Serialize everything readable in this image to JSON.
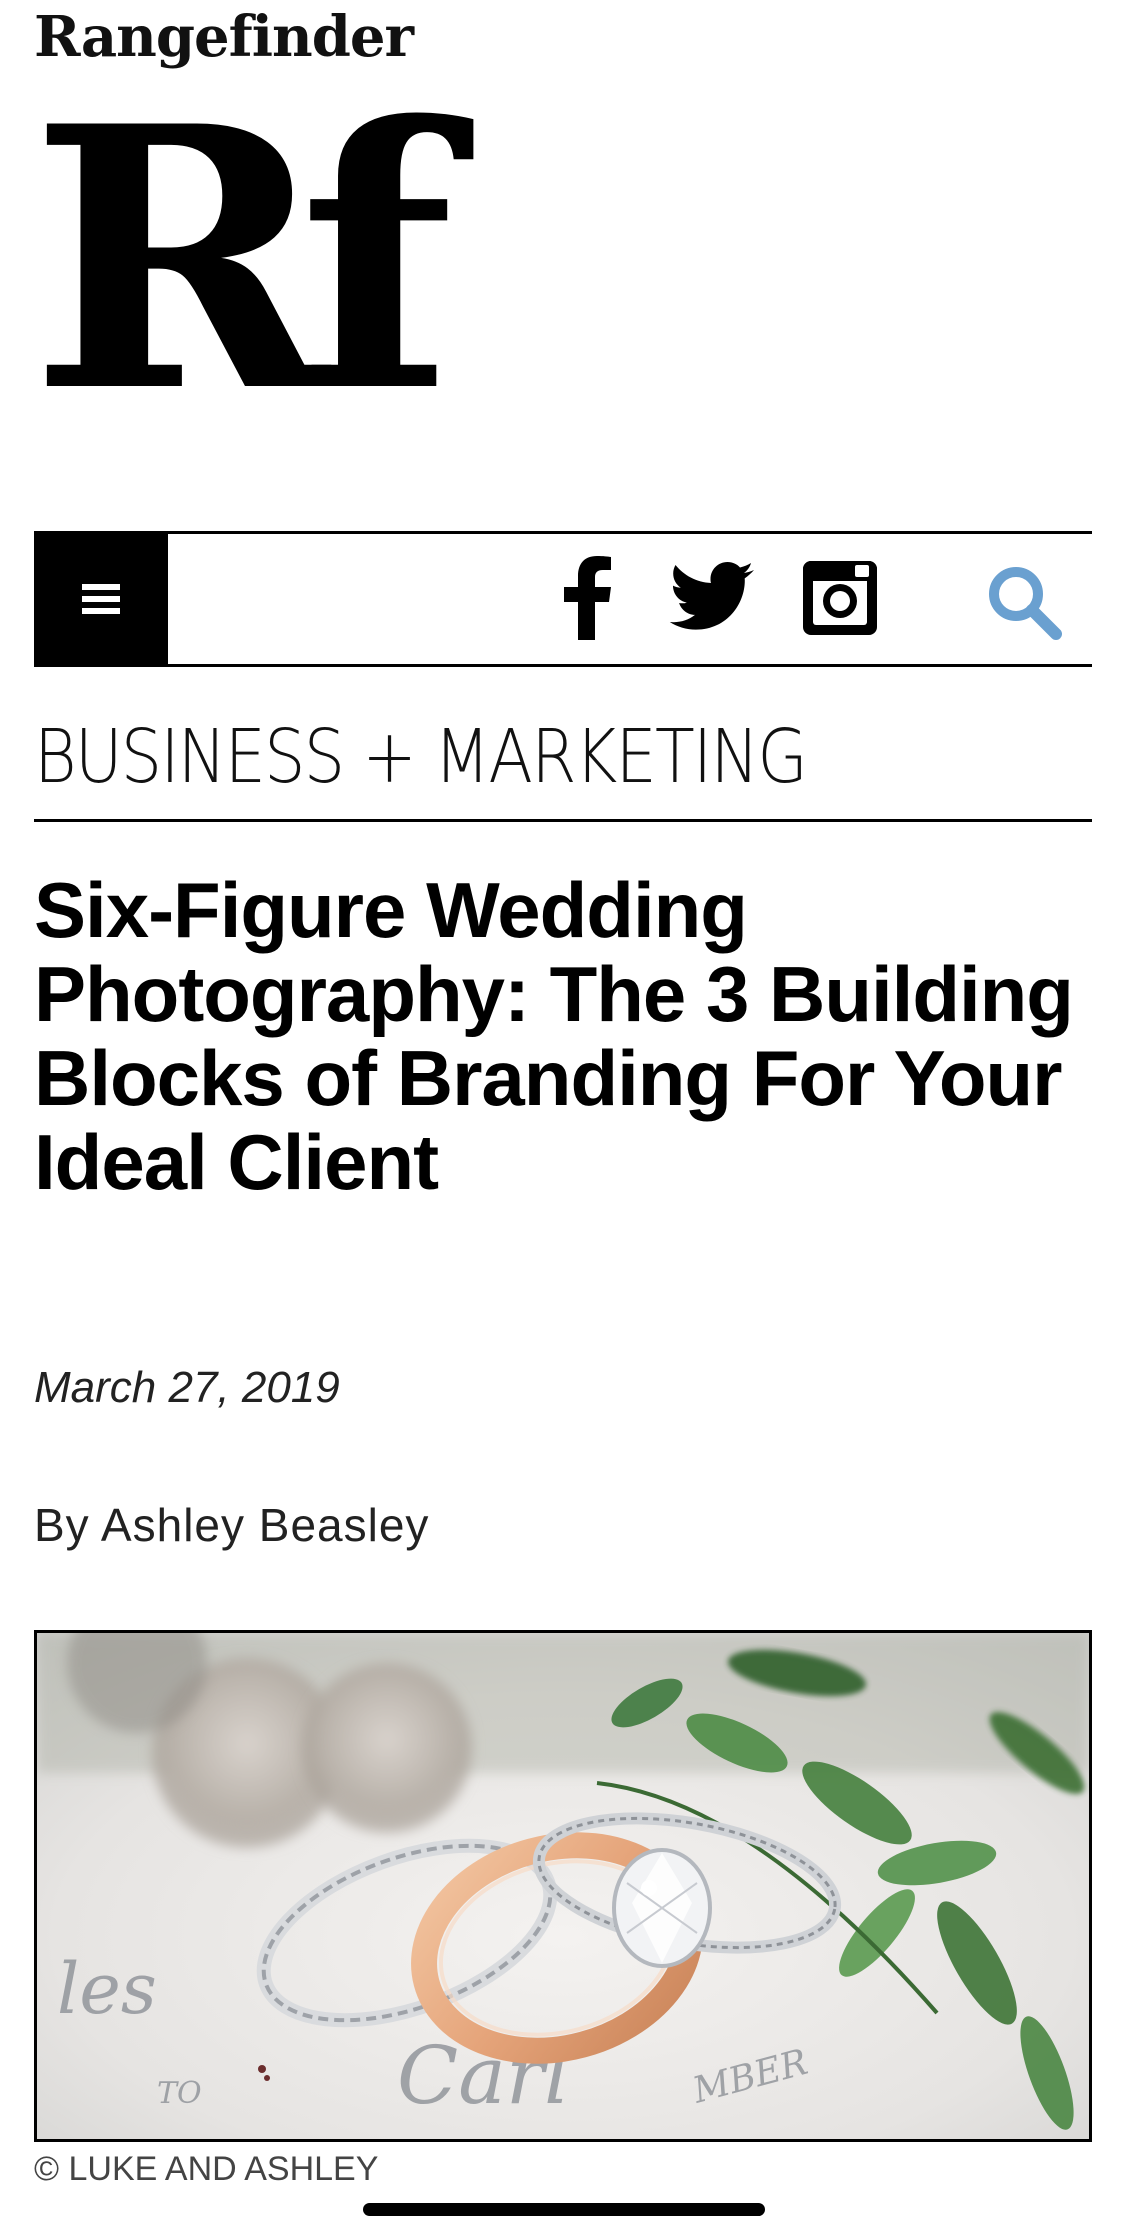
{
  "header": {
    "wordmark": "Rangefinder",
    "monogram": "Rf"
  },
  "nav": {
    "menu_icon": "hamburger-menu-icon",
    "social": [
      {
        "name": "facebook",
        "icon": "facebook-icon"
      },
      {
        "name": "twitter",
        "icon": "twitter-icon"
      },
      {
        "name": "instagram",
        "icon": "instagram-icon"
      }
    ],
    "search_icon": "search-icon",
    "search_color": "#6aa0d0"
  },
  "article": {
    "category": "BUSINESS + MARKETING",
    "title": "Six-Figure Wedding Photography: The 3 Building Blocks of Branding For Your Ideal Client",
    "date": "March 27, 2019",
    "byline": "By Ashley Beasley",
    "hero": {
      "photo_credit": "© LUKE AND ASHLEY",
      "caption_script_1": "les",
      "caption_script_2": "TO",
      "caption_script_3": "Carl",
      "caption_script_4": "MBER"
    }
  }
}
